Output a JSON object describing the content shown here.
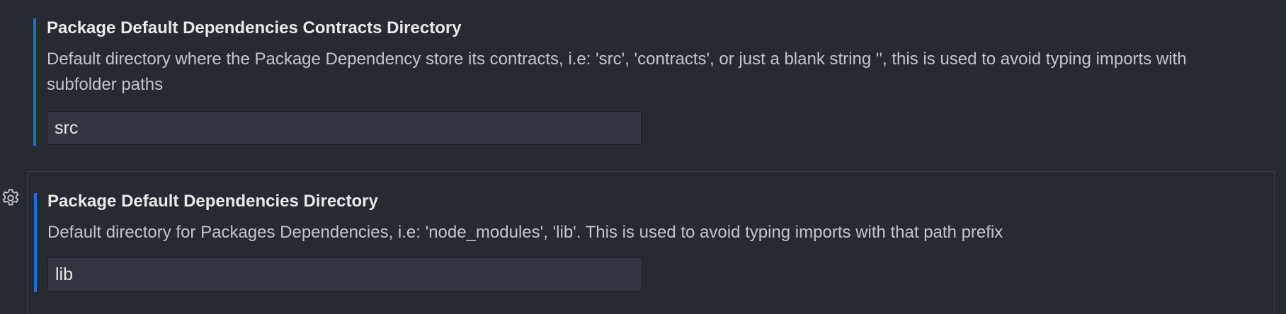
{
  "settings": [
    {
      "title": "Package Default Dependencies Contracts Directory",
      "description": "Default directory where the Package Dependency store its contracts, i.e: 'src', 'contracts', or just a blank string '', this is used to avoid typing imports with subfolder paths",
      "value": "src"
    },
    {
      "title": "Package Default Dependencies Directory",
      "description": "Default directory for Packages Dependencies, i.e: 'node_modules', 'lib'. This is used to avoid typing imports with that path prefix",
      "value": "lib"
    }
  ],
  "icons": {
    "manage": "gear-icon"
  },
  "colors": {
    "background": "#262a33",
    "accent": "#1f6fd6",
    "input_background": "#313640",
    "title": "#e8e8e8",
    "description": "#c2c4c8"
  }
}
